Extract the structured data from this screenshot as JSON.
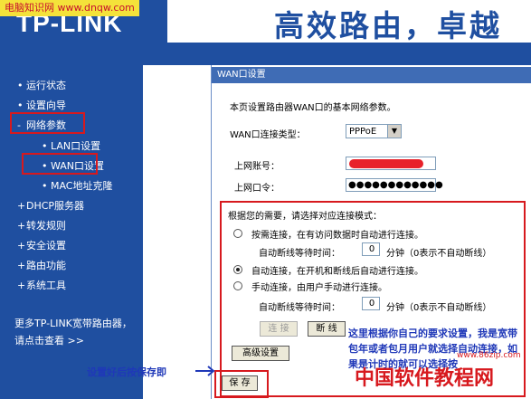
{
  "header": {
    "watermark": "电脑知识网 www.dnqw.com",
    "logo": "TP-LINK",
    "slogan": "高效路由，卓越"
  },
  "sidebar": {
    "items": [
      {
        "label": "运行状态",
        "mark": "•"
      },
      {
        "label": "设置向导",
        "mark": "•"
      },
      {
        "label": "网络参数",
        "mark": "-"
      },
      {
        "label": "DHCP服务器",
        "mark": "+"
      },
      {
        "label": "转发规则",
        "mark": "+"
      },
      {
        "label": "安全设置",
        "mark": "+"
      },
      {
        "label": "路由功能",
        "mark": "+"
      },
      {
        "label": "系统工具",
        "mark": "+"
      }
    ],
    "subitems": [
      {
        "label": "• LAN口设置"
      },
      {
        "label": "• WAN口设置"
      },
      {
        "label": "• MAC地址克隆"
      }
    ],
    "more_text": "更多TP-LINK宽带路由器，请点击查看 >>"
  },
  "panel": {
    "title": "WAN口设置",
    "intro": "本页设置路由器WAN口的基本网络参数。",
    "conn_type_label": "WAN口连接类型：",
    "conn_type_value": "PPPoE",
    "account_label": "上网账号：",
    "password_label": "上网口令：",
    "password_value": "●●●●●●●●●●●●",
    "mode_prompt": "根据您的需要，请选择对应连接模式：",
    "modes": [
      {
        "label": "按需连接，在有访问数据时自动进行连接。",
        "selected": false
      },
      {
        "label": "自动连接，在开机和断线后自动进行连接。",
        "selected": true
      },
      {
        "label": "手动连接，由用户手动进行连接。",
        "selected": false
      }
    ],
    "idle_label": "自动断线等待时间：",
    "idle_value_1": "0",
    "idle_value_2": "0",
    "idle_unit": "分钟（0表示不自动断线）",
    "connect_label": "连 接",
    "disconnect_label": "断 线",
    "advanced_label": "高级设置",
    "save_label": "保 存"
  },
  "annotations": {
    "right_note": "这里根据你自己的要求设置，我是宽带包年或者包月用户就选择自动连接，如果是计时的就可以选择按",
    "left_note": "设置好后按保存即",
    "site_watermark": "中国软件教程网",
    "site_url": "www.86zip.com"
  },
  "colors": {
    "nav_blue": "#1f4fa0",
    "title_blue": "#3f6cb5",
    "highlight_red": "#d7191e",
    "note_blue": "#1f38b8"
  }
}
